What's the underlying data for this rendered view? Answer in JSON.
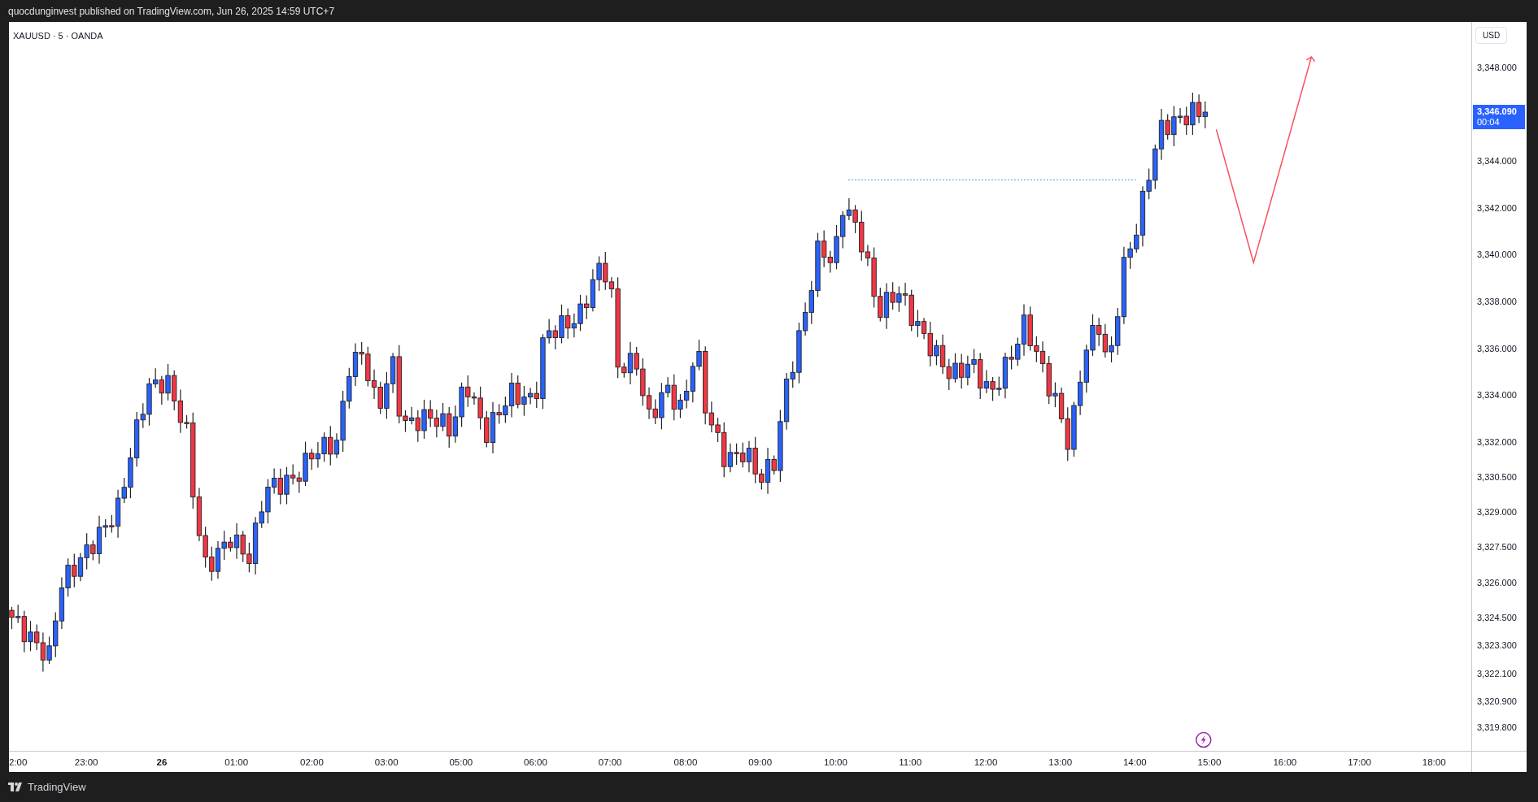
{
  "header": {
    "text": "quocdunginvest published on TradingView.com, Jun 26, 2025 14:59 UTC+7"
  },
  "chart": {
    "symbol": "XAUUSD · 5 · OANDA",
    "currency": "USD",
    "price_axis": [
      "3,348.000",
      "3,344.000",
      "3,342.000",
      "3,340.000",
      "3,338.000",
      "3,336.000",
      "3,334.000",
      "3,332.000",
      "3,330.500",
      "3,329.000",
      "3,327.500",
      "3,326.000",
      "3,324.500",
      "3,323.300",
      "3,322.100",
      "3,320.900",
      "3,319.800"
    ],
    "last_price": {
      "price": "3,346.090",
      "countdown": "00:04"
    },
    "time_axis": [
      {
        "label": "2:00",
        "bold": false
      },
      {
        "label": "23:00",
        "bold": false
      },
      {
        "label": "26",
        "bold": true
      },
      {
        "label": "01:00",
        "bold": false
      },
      {
        "label": "02:00",
        "bold": false
      },
      {
        "label": "03:00",
        "bold": false
      },
      {
        "label": "05:00",
        "bold": false
      },
      {
        "label": "06:00",
        "bold": false
      },
      {
        "label": "07:00",
        "bold": false
      },
      {
        "label": "08:00",
        "bold": false
      },
      {
        "label": "09:00",
        "bold": false
      },
      {
        "label": "10:00",
        "bold": false
      },
      {
        "label": "11:00",
        "bold": false
      },
      {
        "label": "12:00",
        "bold": false
      },
      {
        "label": "13:00",
        "bold": false
      },
      {
        "label": "14:00",
        "bold": false
      },
      {
        "label": "15:00",
        "bold": false
      },
      {
        "label": "16:00",
        "bold": false
      },
      {
        "label": "17:00",
        "bold": false
      },
      {
        "label": "18:00",
        "bold": false
      }
    ]
  },
  "footer": {
    "brand": "TradingView"
  }
}
